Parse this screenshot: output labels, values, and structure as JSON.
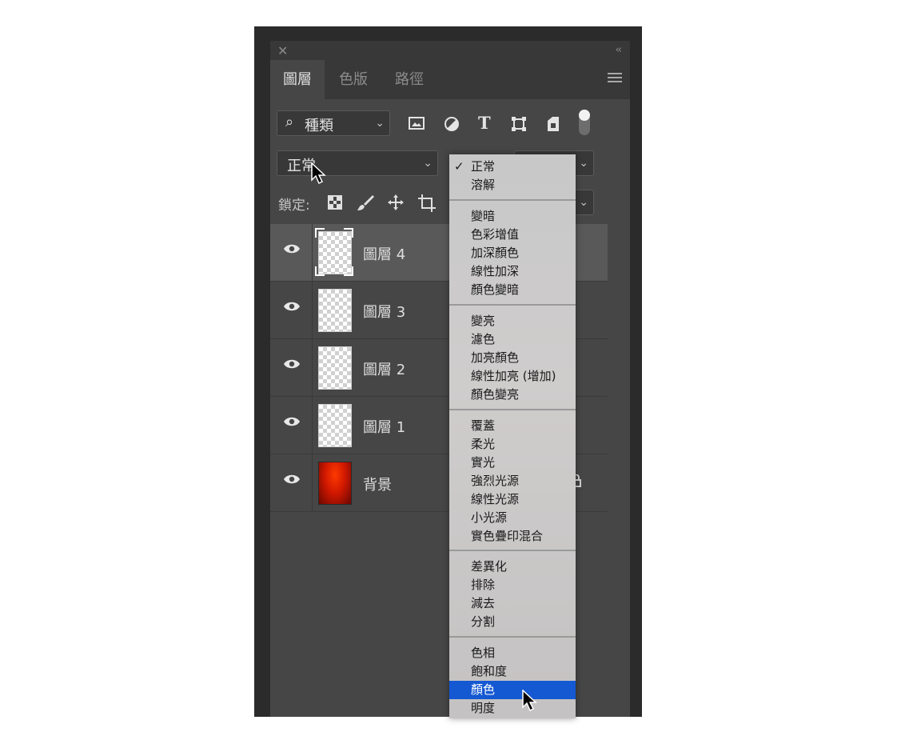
{
  "panel": {
    "close_glyph": "✕",
    "collapse_glyph": "‹‹",
    "tabs": [
      {
        "label": "圖層",
        "active": true
      },
      {
        "label": "色版",
        "active": false
      },
      {
        "label": "路徑",
        "active": false
      }
    ]
  },
  "filter": {
    "kind_label": "種類",
    "icons": [
      "image-filter-icon",
      "adjustment-filter-icon",
      "type-filter-icon",
      "shape-filter-icon",
      "smart-object-filter-icon"
    ],
    "type_glyph": "T"
  },
  "blend": {
    "current_mode": "正常"
  },
  "lock": {
    "label": "鎖定:"
  },
  "layers": [
    {
      "name": "圖層 4",
      "selected": true,
      "thumb": "transparent"
    },
    {
      "name": "圖層 3",
      "selected": false,
      "thumb": "transparent"
    },
    {
      "name": "圖層 2",
      "selected": false,
      "thumb": "transparent"
    },
    {
      "name": "圖層 1",
      "selected": false,
      "thumb": "transparent"
    },
    {
      "name": "背景",
      "selected": false,
      "thumb": "red-gradient",
      "locked": true
    }
  ],
  "blend_menu": {
    "checked_item": "正常",
    "highlighted_item": "顏色",
    "groups": [
      [
        "正常",
        "溶解"
      ],
      [
        "變暗",
        "色彩增值",
        "加深顏色",
        "線性加深",
        "顏色變暗"
      ],
      [
        "變亮",
        "濾色",
        "加亮顏色",
        "線性加亮 (增加)",
        "顏色變亮"
      ],
      [
        "覆蓋",
        "柔光",
        "實光",
        "強烈光源",
        "線性光源",
        "小光源",
        "實色疊印混合"
      ],
      [
        "差異化",
        "排除",
        "減去",
        "分割"
      ],
      [
        "色相",
        "飽和度",
        "顏色",
        "明度"
      ]
    ]
  },
  "colors": {
    "panel_bg": "#464646",
    "highlight": "#1458d2"
  }
}
